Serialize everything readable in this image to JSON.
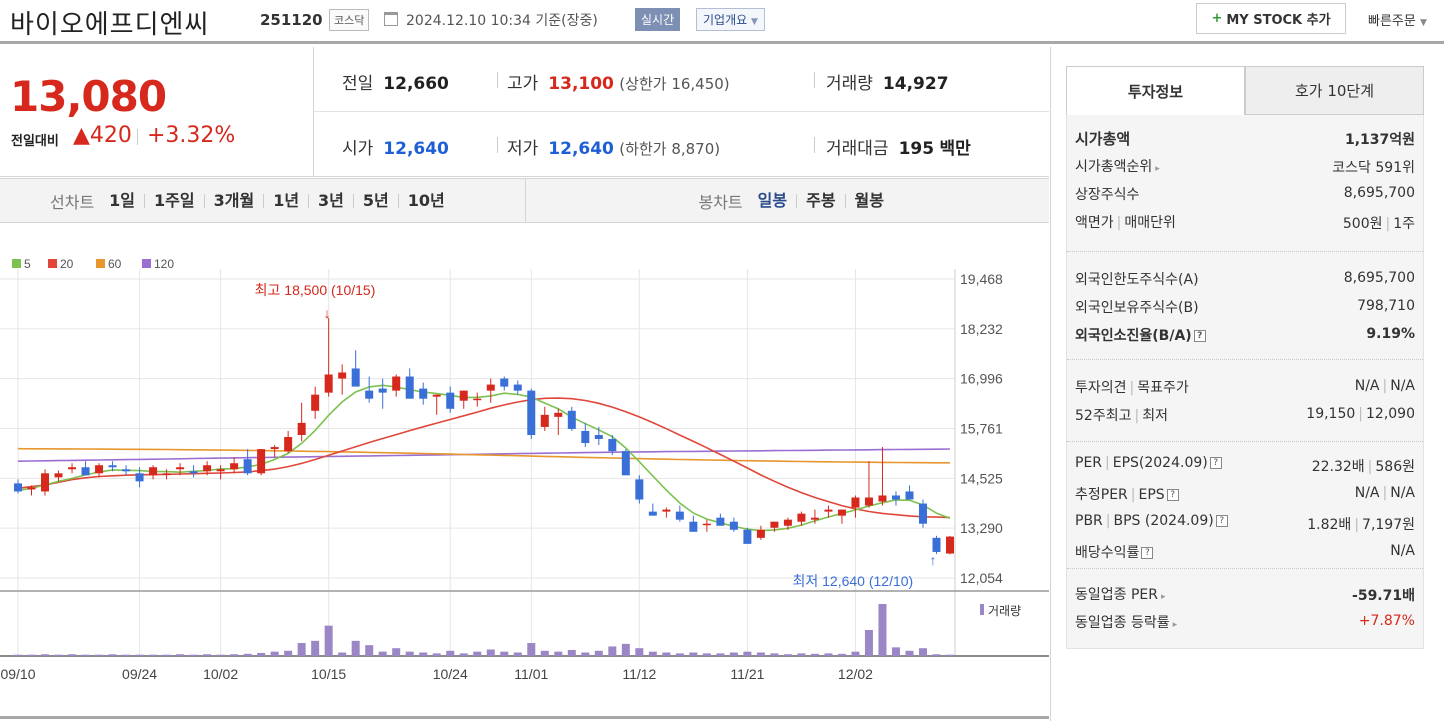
{
  "header": {
    "name": "바이오에프디엔씨",
    "code": "251120",
    "market": "코스닥",
    "datetime": "2024.12.10 10:34  기준(장중)",
    "realtime_label": "실시간",
    "corp_label": "기업개요",
    "mystock_label": "MY STOCK 추가",
    "quick_order": "빠른주문"
  },
  "price": {
    "now": "13,080",
    "change_label": "전일대비",
    "change": "▲420",
    "rate": "+3.32%"
  },
  "info": {
    "prev_k": "전일",
    "prev_v": "12,660",
    "high_k": "고가",
    "high_v": "13,100",
    "upper_limit": "(상한가 16,450)",
    "volume_k": "거래량",
    "volume_v": "14,927",
    "open_k": "시가",
    "open_v": "12,640",
    "low_k": "저가",
    "low_v": "12,640",
    "lower_limit": "(하한가 8,870)",
    "amount_k": "거래대금",
    "amount_v": "195",
    "amount_unit": "백만"
  },
  "period_bar": {
    "line_title": "선차트",
    "line_items": [
      "1일",
      "1주일",
      "3개월",
      "1년",
      "3년",
      "5년",
      "10년"
    ],
    "candle_title": "봉차트",
    "candle_items": [
      "일봉",
      "주봉",
      "월봉"
    ],
    "candle_active": 0
  },
  "colors": {
    "up": "#d6281c",
    "down": "#3a6fd8",
    "ma5": "#7cc250",
    "ma20": "#e0473a",
    "ma60": "#e8962e",
    "ma120": "#9b6fd1",
    "volume": "#9b87c6"
  },
  "chart_data": {
    "type": "candlestick",
    "legend": [
      "5",
      "20",
      "60",
      "120"
    ],
    "y_ticks": [
      "19,468",
      "18,232",
      "16,996",
      "15,761",
      "14,525",
      "13,290",
      "12,054"
    ],
    "y_range": [
      12054,
      19468
    ],
    "x_ticks": [
      "09/10",
      "09/24",
      "10/02",
      "10/15",
      "10/24",
      "11/01",
      "11/12",
      "11/21",
      "12/02"
    ],
    "x_tick_index": [
      0,
      9,
      15,
      23,
      32,
      38,
      46,
      54,
      62
    ],
    "high_note": "최고 18,500 (10/15)",
    "high_index": 23,
    "low_note": "최저 12,640 (12/10)",
    "low_index": 68,
    "volume_label": "거래량",
    "candles": [
      [
        14400,
        14500,
        14150,
        14200
      ],
      [
        14250,
        14350,
        14100,
        14300
      ],
      [
        14200,
        14750,
        14100,
        14650
      ],
      [
        14550,
        14720,
        14450,
        14650
      ],
      [
        14750,
        14900,
        14650,
        14800
      ],
      [
        14800,
        14950,
        14700,
        14600
      ],
      [
        14650,
        14900,
        14550,
        14850
      ],
      [
        14850,
        14950,
        14700,
        14800
      ],
      [
        14750,
        14850,
        14600,
        14700
      ],
      [
        14650,
        14800,
        14300,
        14450
      ],
      [
        14600,
        14850,
        14500,
        14800
      ],
      [
        14650,
        14750,
        14500,
        14650
      ],
      [
        14750,
        14900,
        14600,
        14800
      ],
      [
        14700,
        14850,
        14550,
        14650
      ],
      [
        14700,
        14950,
        14600,
        14850
      ],
      [
        14700,
        14850,
        14500,
        14750
      ],
      [
        14750,
        15050,
        14650,
        14900
      ],
      [
        15000,
        15250,
        14600,
        14650
      ],
      [
        14650,
        15250,
        14600,
        15250
      ],
      [
        15250,
        15350,
        15050,
        15300
      ],
      [
        15200,
        15700,
        15150,
        15550
      ],
      [
        15600,
        16400,
        15450,
        15900
      ],
      [
        16200,
        16800,
        16000,
        16600
      ],
      [
        16650,
        18500,
        16550,
        17100
      ],
      [
        17000,
        17350,
        16600,
        17150
      ],
      [
        17250,
        17700,
        16850,
        16800
      ],
      [
        16700,
        17050,
        16400,
        16500
      ],
      [
        16750,
        17000,
        16250,
        16650
      ],
      [
        16700,
        17100,
        16550,
        17050
      ],
      [
        17050,
        17250,
        16600,
        16500
      ],
      [
        16750,
        16900,
        16350,
        16500
      ],
      [
        16550,
        16600,
        16100,
        16600
      ],
      [
        16650,
        16800,
        16150,
        16250
      ],
      [
        16450,
        16700,
        16250,
        16700
      ],
      [
        16500,
        16650,
        16300,
        16500
      ],
      [
        16700,
        17000,
        16400,
        16850
      ],
      [
        17000,
        17050,
        16700,
        16800
      ],
      [
        16850,
        16950,
        16600,
        16700
      ],
      [
        16700,
        16750,
        15500,
        15600
      ],
      [
        15800,
        16300,
        15700,
        16100
      ],
      [
        16050,
        16250,
        15600,
        16150
      ],
      [
        16200,
        16300,
        15700,
        15750
      ],
      [
        15700,
        15900,
        15300,
        15400
      ],
      [
        15600,
        15800,
        15350,
        15500
      ],
      [
        15500,
        15600,
        15100,
        15200
      ],
      [
        15200,
        15250,
        14800,
        14600
      ],
      [
        14500,
        14600,
        13900,
        14000
      ],
      [
        13700,
        13900,
        13600,
        13600
      ],
      [
        13700,
        13800,
        13550,
        13750
      ],
      [
        13700,
        13850,
        13450,
        13500
      ],
      [
        13450,
        13600,
        13200,
        13200
      ],
      [
        13400,
        13500,
        13200,
        13400
      ],
      [
        13550,
        13650,
        13350,
        13350
      ],
      [
        13450,
        13550,
        13200,
        13250
      ],
      [
        13250,
        13300,
        12950,
        12900
      ],
      [
        13050,
        13350,
        13000,
        13250
      ],
      [
        13300,
        13450,
        13200,
        13450
      ],
      [
        13350,
        13550,
        13250,
        13500
      ],
      [
        13450,
        13700,
        13350,
        13650
      ],
      [
        13500,
        13750,
        13400,
        13550
      ],
      [
        13700,
        13850,
        13550,
        13750
      ],
      [
        13600,
        13750,
        13400,
        13750
      ],
      [
        13800,
        14100,
        13550,
        14050
      ],
      [
        13850,
        14950,
        13800,
        14050
      ],
      [
        13950,
        15300,
        13850,
        14100
      ],
      [
        14100,
        14200,
        13850,
        14000
      ],
      [
        14200,
        14350,
        14000,
        14000
      ],
      [
        13900,
        14000,
        13300,
        13400
      ],
      [
        13050,
        13100,
        12650,
        12700
      ],
      [
        12660,
        13100,
        12640,
        13080
      ]
    ],
    "volumes": [
      3,
      3,
      4,
      3,
      4,
      3,
      3,
      4,
      3,
      3,
      3,
      3,
      4,
      3,
      4,
      3,
      4,
      5,
      7,
      10,
      12,
      30,
      35,
      70,
      8,
      35,
      25,
      10,
      18,
      10,
      8,
      6,
      12,
      6,
      10,
      15,
      10,
      8,
      30,
      12,
      10,
      14,
      8,
      12,
      22,
      28,
      18,
      10,
      8,
      6,
      8,
      6,
      6,
      8,
      10,
      8,
      6,
      4,
      6,
      5,
      6,
      5,
      10,
      60,
      120,
      20,
      12,
      18,
      4,
      3
    ]
  },
  "right_panel": {
    "tabs": [
      "투자정보",
      "호가 10단계"
    ],
    "sec1": [
      {
        "k": "시가총액",
        "v": "1,137억원"
      },
      {
        "k": "시가총액순위",
        "v": "코스닥 591위"
      },
      {
        "k": "상장주식수",
        "v": "8,695,700"
      },
      {
        "k": "액면가",
        "k2": "매매단위",
        "v": "500원",
        "v2": "1주"
      }
    ],
    "sec2": [
      {
        "k": "외국인한도주식수(A)",
        "v": "8,695,700"
      },
      {
        "k": "외국인보유주식수(B)",
        "v": "798,710"
      },
      {
        "k": "외국인소진율(B/A)",
        "v": "9.19%"
      }
    ],
    "sec3": [
      {
        "k": "투자의견",
        "k2": "목표주가",
        "v": "N/A",
        "v2": "N/A"
      },
      {
        "k": "52주최고",
        "k2": "최저",
        "v": "19,150",
        "v2": "12,090"
      }
    ],
    "sec4": [
      {
        "k": "PER",
        "k2": "EPS(2024.09)",
        "v": "22.32배",
        "v2": "586원"
      },
      {
        "k": "추정PER",
        "k2": "EPS",
        "v": "N/A",
        "v2": "N/A"
      },
      {
        "k": "PBR",
        "k2": "BPS (2024.09)",
        "v": "1.82배",
        "v2": "7,197원"
      },
      {
        "k": "배당수익률",
        "v": "N/A"
      }
    ],
    "sec5": [
      {
        "k": "동일업종 PER",
        "v": "-59.71배"
      },
      {
        "k": "동일업종 등락률",
        "v": "+7.87%"
      }
    ]
  }
}
